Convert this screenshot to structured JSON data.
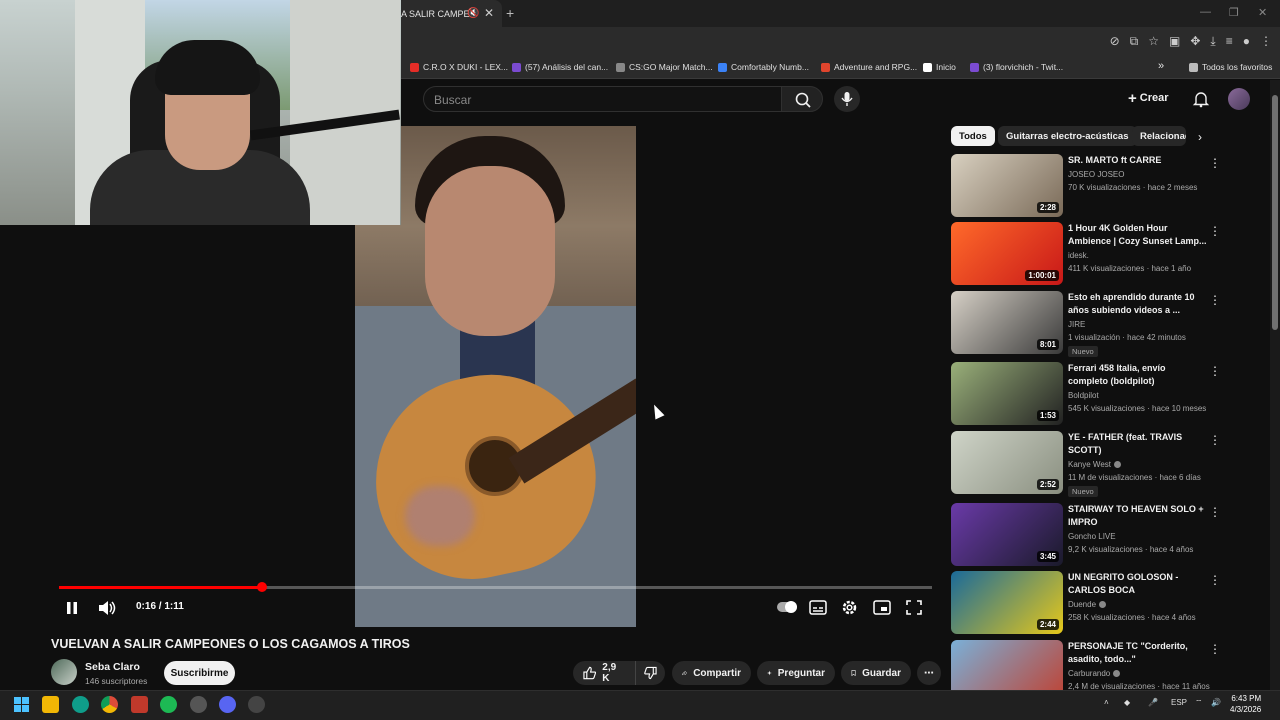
{
  "browser": {
    "tab_title": "A SALIR CAMPEO",
    "tab_close": "✕",
    "new_tab": "+",
    "bookmarks": [
      {
        "label": "C.R.O X DUKI - LEX...",
        "color": "#e52d27"
      },
      {
        "label": "(57) Análisis del can...",
        "color": "#7b4bd1"
      },
      {
        "label": "CS:GO Major Match...",
        "color": "#888888"
      },
      {
        "label": "Comfortably Numb...",
        "color": "#3b82f6"
      },
      {
        "label": "Adventure and RPG...",
        "color": "#e0452d"
      },
      {
        "label": "Inicio",
        "color": "#ffffff"
      },
      {
        "label": "(3) florvichich - Twit...",
        "color": "#7b4bd1"
      }
    ],
    "bookmarks_more": "»",
    "all_favorites": "Todos los favoritos"
  },
  "youtube": {
    "search_placeholder": "Buscar",
    "create_label": "Crear"
  },
  "player": {
    "time": "0:16 / 1:11",
    "progress": 0.233
  },
  "video": {
    "title": "VUELVAN A SALIR CAMPEONES O LOS CAGAMOS A TIROS",
    "channel": "Seba Claro",
    "subscribers": "146 suscriptores",
    "subscribe_label": "Suscribirme",
    "likes": "2,9 K",
    "share_label": "Compartir",
    "ask_label": "Preguntar",
    "save_label": "Guardar"
  },
  "chips": [
    "Todos",
    "Guitarras electro-acústicas",
    "Relacionad"
  ],
  "recommendations": [
    {
      "title": "SR. MARTO ft CARRE",
      "channel": "JOSEO JOSEO",
      "meta": "70 K visualizaciones · hace 2 meses",
      "duration": "2:28",
      "new": false,
      "verified": false,
      "colors": [
        "#d8d0c0",
        "#7a6a58"
      ]
    },
    {
      "title": "1 Hour 4K Golden Hour Ambience | Cozy Sunset Lamp...",
      "channel": "idesk.",
      "meta": "411 K visualizaciones · hace 1 año",
      "duration": "1:00:01",
      "new": false,
      "verified": false,
      "colors": [
        "#ff6a2a",
        "#c81818"
      ]
    },
    {
      "title": "Esto eh aprendido durante 10 años subiendo videos a ...",
      "channel": "JIRE",
      "meta": "1 visualización · hace 42 minutos",
      "duration": "8:01",
      "new": true,
      "verified": false,
      "colors": [
        "#d6d0c6",
        "#3a3a3a"
      ]
    },
    {
      "title": "Ferrari 458 Italia, envío completo (boldpilot)",
      "channel": "Boldpilot",
      "meta": "545 K visualizaciones · hace 10 meses",
      "duration": "1:53",
      "new": false,
      "verified": false,
      "colors": [
        "#9ab07a",
        "#222222"
      ]
    },
    {
      "title": "YE - FATHER (feat. TRAVIS SCOTT)",
      "channel": "Kanye West",
      "meta": "11 M de visualizaciones · hace 6 días",
      "duration": "2:52",
      "new": true,
      "verified": true,
      "colors": [
        "#cfd4c8",
        "#8a8f80"
      ]
    },
    {
      "title": "STAIRWAY TO HEAVEN SOLO + IMPRO",
      "channel": "Goncho LIVE",
      "meta": "9,2 K visualizaciones · hace 4 años",
      "duration": "3:45",
      "new": false,
      "verified": false,
      "colors": [
        "#6a3aa8",
        "#1a1a2a"
      ]
    },
    {
      "title": "UN NEGRITO GOLOSON - CARLOS BOCA",
      "channel": "Duende",
      "meta": "258 K visualizaciones · hace 4 años",
      "duration": "2:44",
      "new": false,
      "verified": true,
      "colors": [
        "#1a6a9a",
        "#e6c81a"
      ]
    },
    {
      "title": "PERSONAJE TC \"Corderito, asadito, todo...\"",
      "channel": "Carburando",
      "meta": "2,4 M de visualizaciones · hace 11 años",
      "duration": "",
      "new": false,
      "verified": true,
      "colors": [
        "#7ab0d8",
        "#c04030"
      ]
    }
  ],
  "new_badge": "Nuevo",
  "taskbar": {
    "lang": "ESP",
    "time": "6:43 PM",
    "date": "4/3/2026"
  },
  "icons": {
    "colors": [
      "#0078d4",
      "#f2b705",
      "#0f9d58",
      "#dd4b39",
      "#1db954",
      "#5865f2",
      "#666666"
    ]
  }
}
